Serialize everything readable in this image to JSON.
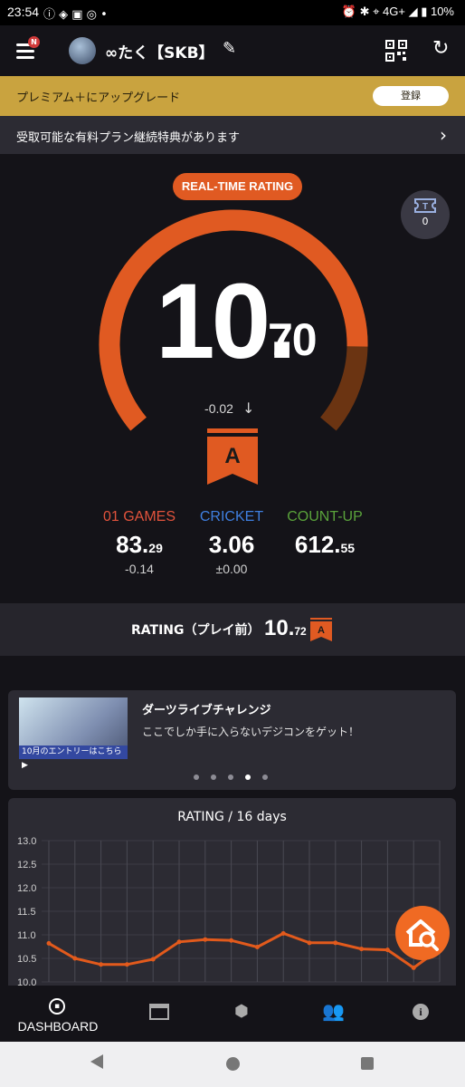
{
  "status_bar": {
    "time": "23:54",
    "network": "4G+",
    "battery": "10%"
  },
  "header": {
    "username": "∞たく【SKB】",
    "notification_badge": "N"
  },
  "premium_banner": {
    "text": "プレミアム＋にアップグレード",
    "button": "登録"
  },
  "benefit_banner": {
    "text": "受取可能な有料プラン継続特典があります"
  },
  "rating": {
    "badge": "REAL-TIME RATING",
    "value_int": "10.",
    "value_dec": "70",
    "delta": "-0.02",
    "flight": "A",
    "gauge_fraction": 0.85
  },
  "tickets": {
    "count": "0"
  },
  "stats": [
    {
      "label": "01 GAMES",
      "value": "83.",
      "value_small": "29",
      "delta": "-0.14",
      "color": "#e2533c"
    },
    {
      "label": "CRICKET",
      "value": "3.06",
      "value_small": "",
      "delta": "±0.00",
      "color": "#3f7fe0"
    },
    {
      "label": "COUNT-UP",
      "value": "612.",
      "value_small": "55",
      "delta": "",
      "color": "#5aa33b"
    }
  ],
  "previous_rating": {
    "label": "RATING（プレイ前）",
    "value_int": "10.",
    "value_dec": "72",
    "flight": "A"
  },
  "carousel": {
    "title": "ダーツライブチャレンジ",
    "description": "ここでしか手に入らないデジコンをゲット！",
    "thumb_caption": "10月のエントリーはこちら▶",
    "dots": 5,
    "active_dot": 3
  },
  "chart_data": {
    "type": "line",
    "title": "RATING / 16 days",
    "ylim": [
      10.0,
      13.0
    ],
    "yticks": [
      "13.0",
      "12.5",
      "12.0",
      "11.5",
      "11.0",
      "10.5",
      "10.0"
    ],
    "values": [
      10.82,
      10.5,
      10.37,
      10.37,
      10.48,
      10.85,
      10.9,
      10.88,
      10.74,
      11.03,
      10.83,
      10.83,
      10.7,
      10.68,
      10.3,
      10.7
    ],
    "color": "#e25a1c"
  },
  "bottom_nav": {
    "active_label": "DASHBOARD"
  }
}
